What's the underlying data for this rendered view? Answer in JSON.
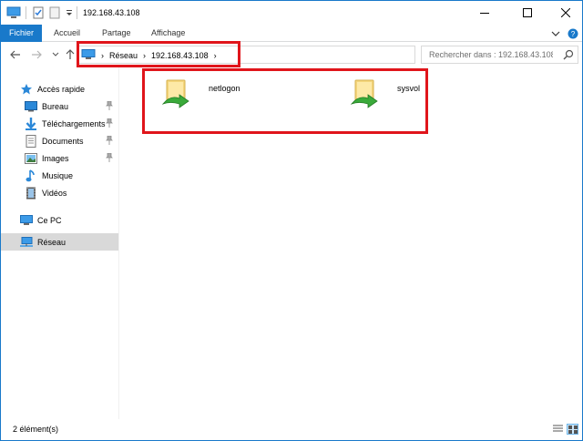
{
  "window": {
    "title": "192.168.43.108",
    "controls": {
      "minimize": "—",
      "maximize": "☐",
      "close": "✕"
    }
  },
  "ribbon": {
    "tabs": [
      {
        "label": "Fichier",
        "active": true
      },
      {
        "label": "Accueil"
      },
      {
        "label": "Partage"
      },
      {
        "label": "Affichage"
      }
    ],
    "expand_icon": "chevron-down-icon",
    "help_icon": "help-icon"
  },
  "nav": {
    "back_icon": "back-arrow-icon",
    "forward_icon": "forward-arrow-icon",
    "recent_icon": "chevron-down-icon",
    "up_icon": "up-arrow-icon",
    "breadcrumb": [
      {
        "label": "Réseau"
      },
      {
        "label": "192.168.43.108"
      }
    ],
    "separator": "›",
    "search": {
      "placeholder": "Rechercher dans : 192.168.43.108"
    }
  },
  "sidebar": {
    "items": [
      {
        "label": "Accès rapide",
        "icon": "star-icon"
      },
      {
        "label": "Bureau",
        "icon": "desktop-icon",
        "pinned": true
      },
      {
        "label": "Téléchargements",
        "icon": "download-icon",
        "pinned": true
      },
      {
        "label": "Documents",
        "icon": "documents-icon",
        "pinned": true
      },
      {
        "label": "Images",
        "icon": "pictures-icon",
        "pinned": true
      },
      {
        "label": "Musique",
        "icon": "music-icon"
      },
      {
        "label": "Vidéos",
        "icon": "video-icon"
      },
      {
        "label": "Ce PC",
        "icon": "computer-icon"
      },
      {
        "label": "Réseau",
        "icon": "network-icon",
        "selected": true
      }
    ]
  },
  "content": {
    "items": [
      {
        "name": "netlogon",
        "icon": "shared-folder-icon"
      },
      {
        "name": "sysvol",
        "icon": "shared-folder-icon"
      }
    ]
  },
  "status": {
    "count_text": "2 élément(s)"
  },
  "colors": {
    "accent": "#1979ca",
    "highlight": "#e0151b",
    "selected_bg": "#d9d9d9"
  }
}
